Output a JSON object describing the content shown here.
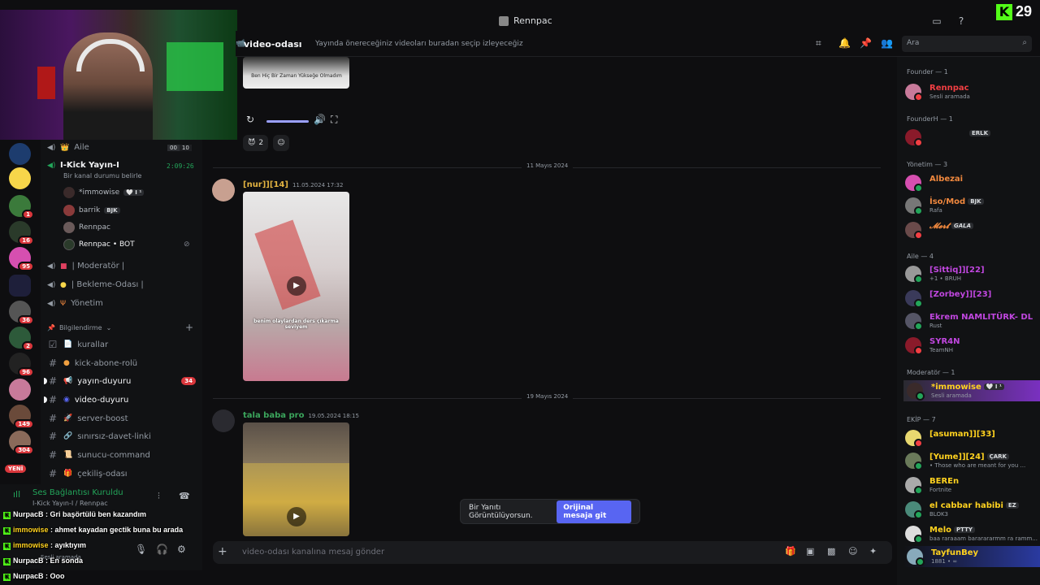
{
  "window": {
    "title": "Rennpac",
    "kick_count": "29"
  },
  "header": {
    "channel": "video-odası",
    "topic": "Yayında önereceğiniz videoları buradan seçip izleyeceğiz",
    "search_placeholder": "Ara"
  },
  "voice": {
    "aile": {
      "label": "Aile",
      "count_a": "00",
      "count_b": "10"
    },
    "kick": {
      "label": "I-Kick Yayın-I",
      "timer": "2:09:26",
      "status": "Bir kanal durumu belirle"
    },
    "participants": [
      {
        "name": "*immowise",
        "tag": "🤍 I ¹"
      },
      {
        "name": "barrik",
        "tag": "BJK"
      },
      {
        "name": "Rennpac",
        "tag": ""
      },
      {
        "name": "Rennpac • BOT",
        "tag": ""
      }
    ],
    "channels": [
      {
        "label": "| Moderatör |"
      },
      {
        "label": "| Bekleme-Odası |"
      },
      {
        "label": "Yönetim"
      }
    ]
  },
  "category": {
    "label": "Bilgilendirme"
  },
  "text_channels": [
    {
      "label": "kurallar",
      "unread": false,
      "mention": ""
    },
    {
      "label": "kick-abone-rolü",
      "unread": false,
      "mention": ""
    },
    {
      "label": "yayın-duyuru",
      "unread": true,
      "mention": "34"
    },
    {
      "label": "video-duyuru",
      "unread": true,
      "mention": ""
    },
    {
      "label": "server-boost",
      "unread": false,
      "mention": ""
    },
    {
      "label": "sınırsız-davet-linki",
      "unread": false,
      "mention": ""
    },
    {
      "label": "sunucu-command",
      "unread": false,
      "mention": ""
    },
    {
      "label": "çekiliş-odası",
      "unread": false,
      "mention": ""
    }
  ],
  "servers": {
    "badges": [
      "1",
      "16",
      "95",
      "36",
      "2",
      "96",
      "149",
      "304"
    ],
    "new_label": "YENİ"
  },
  "voice_panel": {
    "status": "Ses Bağlantısı Kuruldu",
    "channel": "I-Kick Yayın-I / Rennpac",
    "user_status": "Sesli aramada"
  },
  "stream_chat": [
    {
      "user": "NurpacB",
      "text": ": Gri başörtülü ben kazandım",
      "color": "#ffffff"
    },
    {
      "user": "immowise",
      "text": ": ahmet kayadan gectik buna bu arada",
      "color": "#ffd21f"
    },
    {
      "user": "immowise",
      "text": ": ayıktıyım",
      "color": "#ffd21f"
    },
    {
      "user": "NurpacB",
      "text": ": En sonda",
      "color": "#ffffff"
    },
    {
      "user": "NurpacB",
      "text": ": Ooo",
      "color": "#ffffff"
    }
  ],
  "messages": {
    "top_video_caption": "Ben Hiç Bir Zaman Yükseğe Olmadım",
    "reaction_count": "2",
    "dividers": [
      "11 Mayıs 2024",
      "19 Mayıs 2024"
    ],
    "msg1": {
      "author": "[nur]][14]",
      "time": "11.05.2024 17:32",
      "color": "#e3b341",
      "caption": "benim olaylardan ders çıkarma seviyem"
    },
    "msg2": {
      "author": "tala baba pro",
      "time": "19.05.2024 18:15",
      "color": "#3ba55c"
    }
  },
  "banner": {
    "text": "Bir Yanıtı Görüntülüyorsun.",
    "button": "Orijinal mesaja git"
  },
  "composer": {
    "placeholder": "video-odası kanalına mesaj gönder"
  },
  "members": {
    "groups": [
      {
        "label": "Founder — 1"
      },
      {
        "label": "FounderH — 1"
      },
      {
        "label": "Yönetim — 3"
      },
      {
        "label": "Aile — 4"
      },
      {
        "label": "Moderatör — 1"
      },
      {
        "label": "EKİP — 7"
      }
    ],
    "list": [
      {
        "name": "Rennpac",
        "tag": "",
        "sub": "Sesli aramada",
        "color": "#f23f43"
      },
      {
        "name": "",
        "tag": "ERLK",
        "sub": "",
        "color": "#f23f43"
      },
      {
        "name": "Albezai",
        "tag": "",
        "sub": "",
        "color": "#f0883e"
      },
      {
        "name": "İso/Mod",
        "tag": "BJK",
        "sub": "Rafa",
        "color": "#f0883e"
      },
      {
        "name": "𝓜𝓮𝓻𝓽",
        "tag": "GALA",
        "sub": "",
        "color": "#f0883e"
      },
      {
        "name": "[Sittiq]][22]",
        "tag": "",
        "sub": "+1 • BRUH",
        "color": "#c147e0"
      },
      {
        "name": "[Zorbey]][23]",
        "tag": "",
        "sub": "",
        "color": "#c147e0"
      },
      {
        "name": "Ekrem NAMLITÜRK- DL",
        "tag": "",
        "sub": "Rust",
        "color": "#c147e0"
      },
      {
        "name": "SYR4N",
        "tag": "",
        "sub": "TeamNH",
        "color": "#c147e0"
      },
      {
        "name": "*immowise",
        "tag": "🤍 I ¹",
        "sub": "Sesli aramada",
        "color": "#ffd21f"
      },
      {
        "name": "[asuman]][33]",
        "tag": "",
        "sub": "",
        "color": "#ffd21f"
      },
      {
        "name": "[Yume]][24]",
        "tag": "ÇARK",
        "sub": "• Those who are meant for you ...",
        "color": "#ffd21f"
      },
      {
        "name": "BEREn",
        "tag": "",
        "sub": "Fortnite",
        "color": "#ffd21f"
      },
      {
        "name": "el cabbar habibi",
        "tag": "EZ",
        "sub": "BLOK3",
        "color": "#ffd21f"
      },
      {
        "name": "Melo",
        "tag": "PTTY",
        "sub": "baa raraaam bararararmm ra ramm...",
        "color": "#ffd21f"
      },
      {
        "name": "TayfunBey",
        "tag": "",
        "sub": "1881 • ∞",
        "color": "#ffd21f"
      }
    ]
  }
}
